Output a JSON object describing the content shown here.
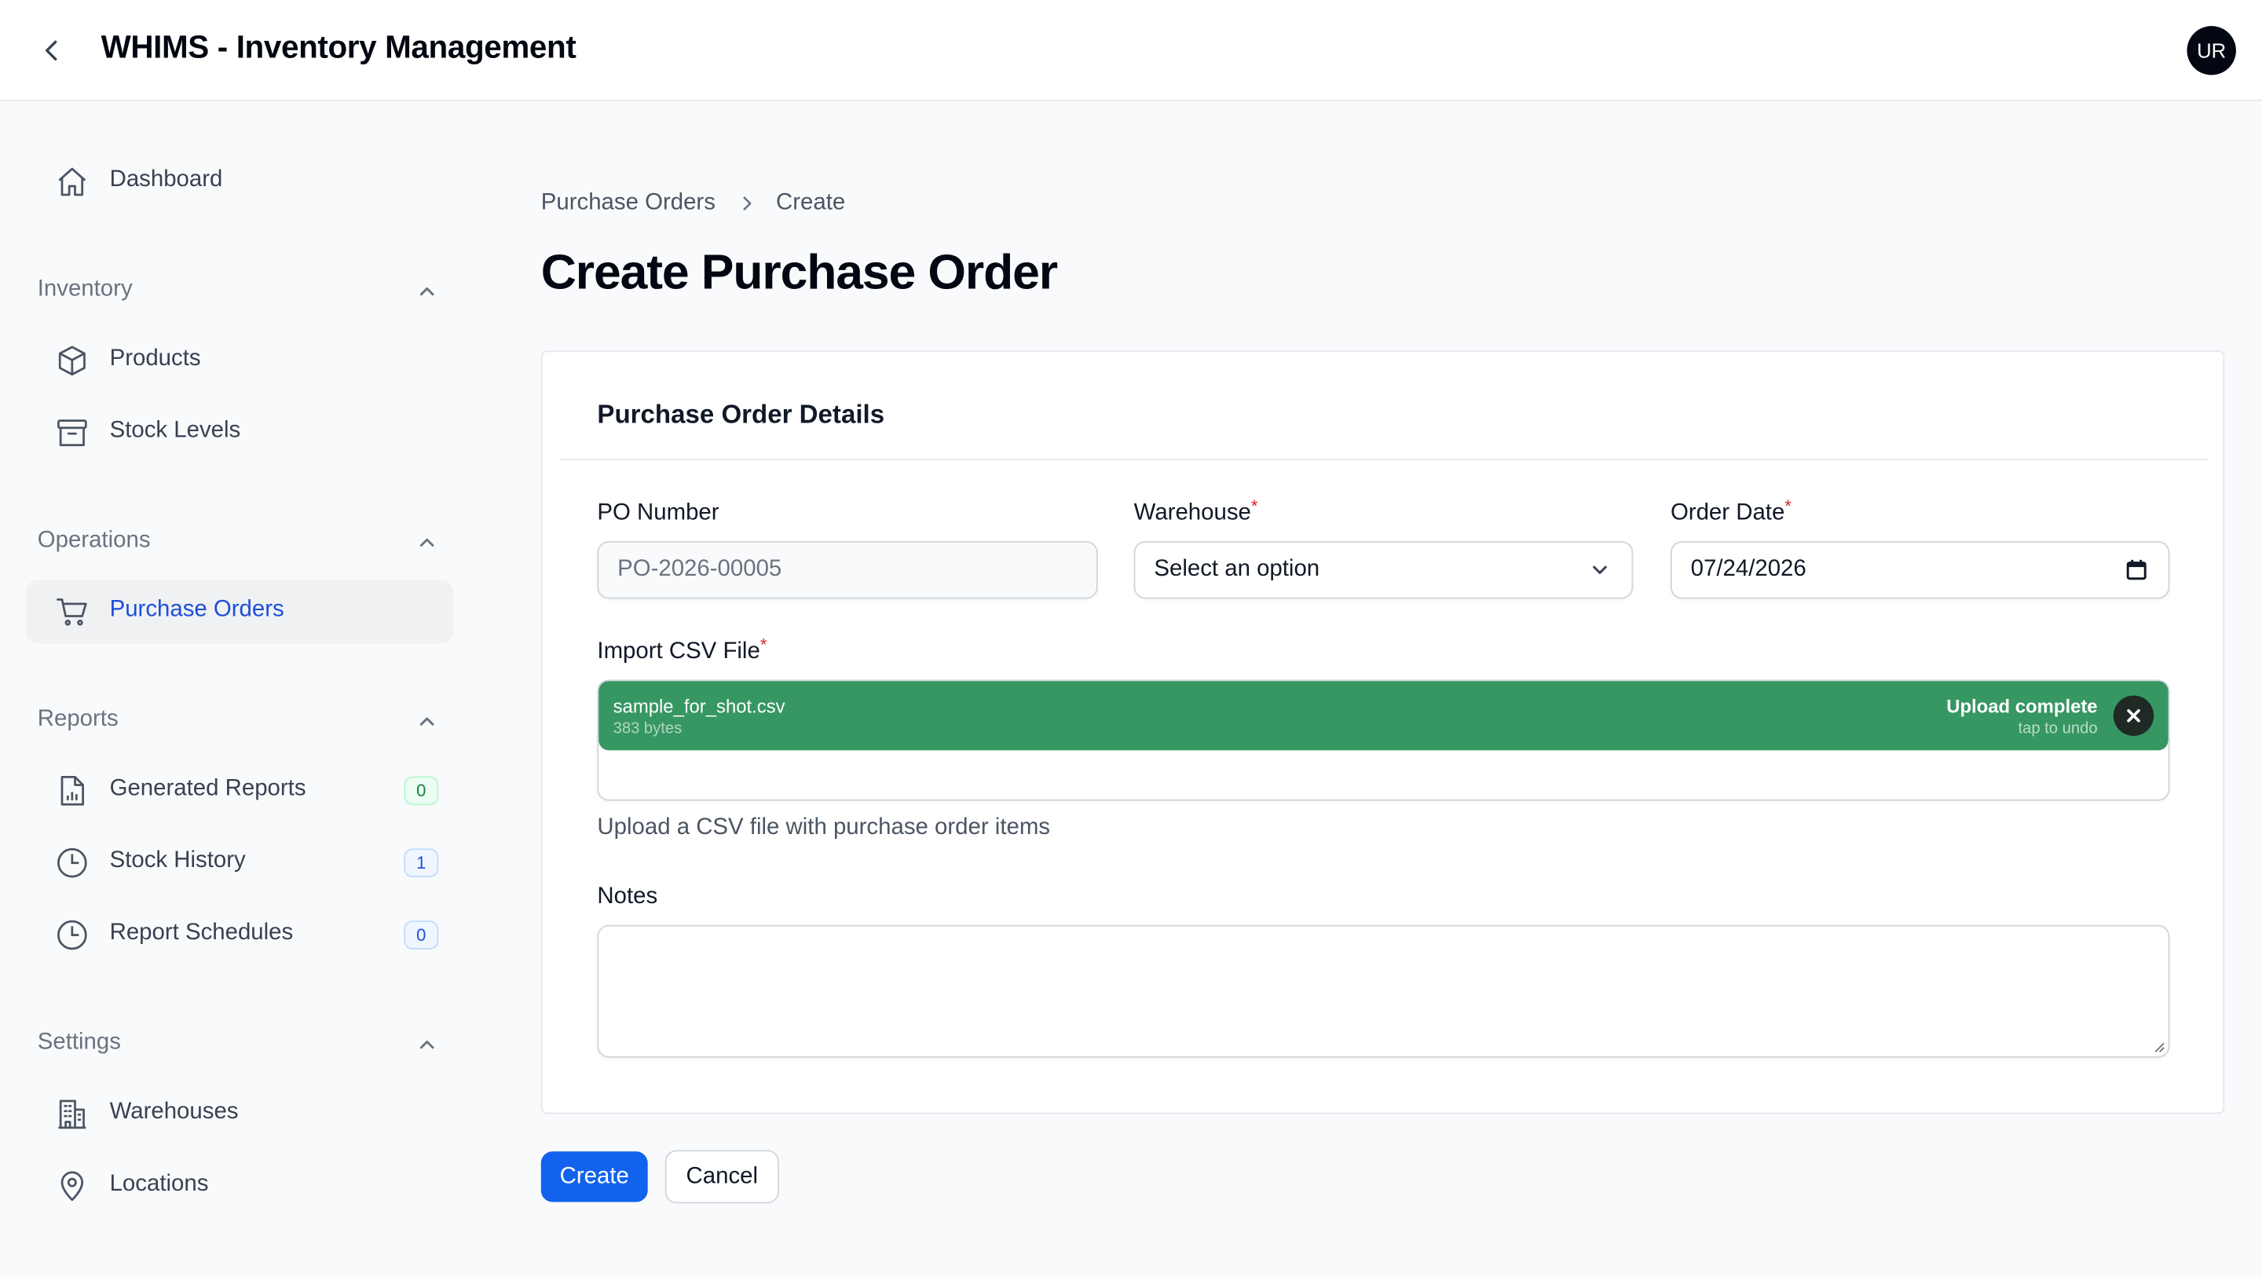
{
  "header": {
    "title": "WHIMS - Inventory Management",
    "avatar_initials": "UR"
  },
  "sidebar": {
    "dashboard_label": "Dashboard",
    "groups": [
      {
        "label": "Inventory",
        "items": [
          {
            "label": "Products"
          },
          {
            "label": "Stock Levels"
          }
        ]
      },
      {
        "label": "Operations",
        "items": [
          {
            "label": "Purchase Orders",
            "active": true
          }
        ]
      },
      {
        "label": "Reports",
        "items": [
          {
            "label": "Generated Reports",
            "badge": "0"
          },
          {
            "label": "Stock History",
            "badge": "1"
          },
          {
            "label": "Report Schedules",
            "badge": "0"
          }
        ]
      },
      {
        "label": "Settings",
        "items": [
          {
            "label": "Warehouses"
          },
          {
            "label": "Locations"
          }
        ]
      }
    ]
  },
  "breadcrumb": {
    "parent": "Purchase Orders",
    "current": "Create"
  },
  "page_title": "Create Purchase Order",
  "form": {
    "section_title": "Purchase Order Details",
    "po_number": {
      "label": "PO Number",
      "value": "PO-2026-00005"
    },
    "warehouse": {
      "label": "Warehouse",
      "required_mark": "*",
      "value": "Select an option"
    },
    "order_date": {
      "label": "Order Date",
      "required_mark": "*",
      "value": "07/24/2026"
    },
    "csv": {
      "label": "Import CSV File",
      "required_mark": "*",
      "file_name": "sample_for_shot.csv",
      "file_size": "383 bytes",
      "status": "Upload complete",
      "undo_hint": "tap to undo",
      "helper": "Upload a CSV file with purchase order items"
    },
    "notes": {
      "label": "Notes",
      "value": ""
    }
  },
  "actions": {
    "create_label": "Create",
    "cancel_label": "Cancel"
  },
  "colors": {
    "primary": "#1262ed",
    "active_nav_text": "#1d4ed8",
    "upload_success": "#369763",
    "required": "#dc2626"
  }
}
